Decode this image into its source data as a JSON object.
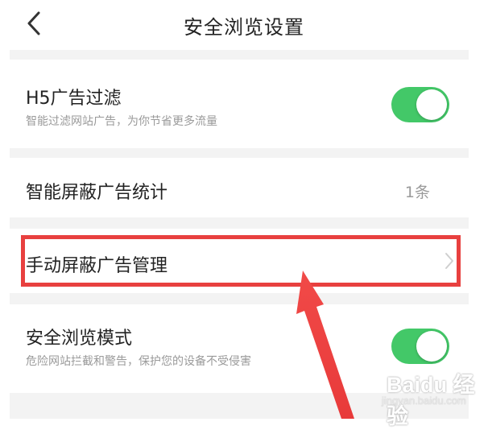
{
  "header": {
    "title": "安全浏览设置",
    "back_icon": "chevron-left-icon"
  },
  "settings": {
    "h5_filter": {
      "title": "H5广告过滤",
      "subtitle": "智能过滤网站广告，为你节省更多流量",
      "enabled": true
    },
    "ad_stats": {
      "title": "智能屏蔽广告统计",
      "value": "1条"
    },
    "manual_block": {
      "title": "手动屏蔽广告管理",
      "chevron_icon": "chevron-right-icon"
    },
    "safe_mode": {
      "title": "安全浏览模式",
      "subtitle": "危险网站拦截和警告，保护您的设备不受侵害",
      "enabled": true
    }
  },
  "colors": {
    "toggle_on": "#43c868",
    "highlight": "#e8403f",
    "section_gap": "#f3f3f3"
  },
  "watermark": {
    "logo": "Baidu 经验",
    "site": "jingyan.baidu.com"
  }
}
